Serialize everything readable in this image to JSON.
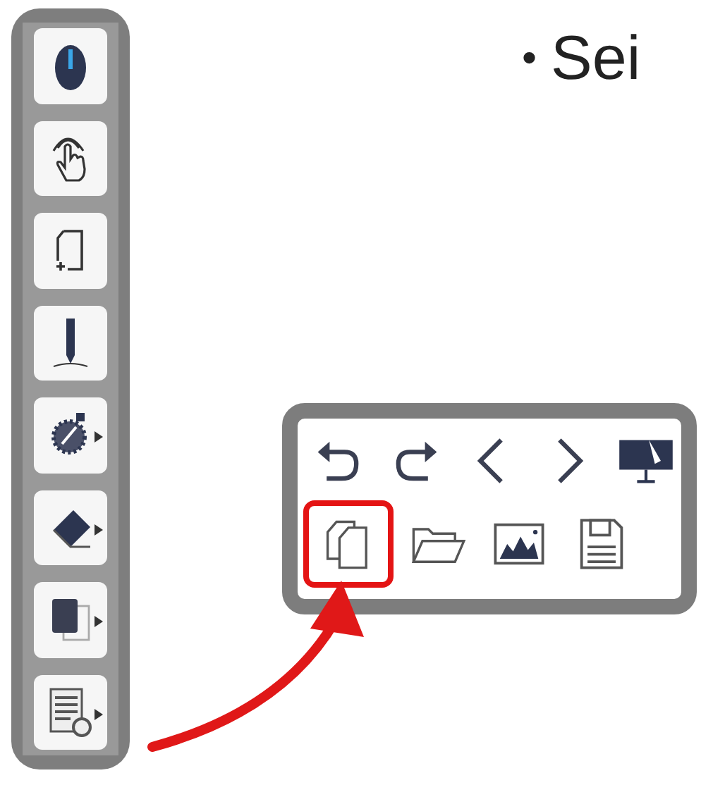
{
  "slide_text": {
    "bullet": "•",
    "text": "Sei"
  },
  "left_toolbar": {
    "tools": [
      {
        "kind": "mouse",
        "submenu": false
      },
      {
        "kind": "touch",
        "submenu": false
      },
      {
        "kind": "page",
        "submenu": false
      },
      {
        "kind": "pen",
        "submenu": false
      },
      {
        "kind": "dial",
        "submenu": true
      },
      {
        "kind": "eraser",
        "submenu": true
      },
      {
        "kind": "shape",
        "submenu": true
      },
      {
        "kind": "document",
        "submenu": true
      }
    ]
  },
  "floating_toolbar": {
    "rows": [
      [
        {
          "kind": "undo",
          "highlighted": false
        },
        {
          "kind": "redo",
          "highlighted": false
        },
        {
          "kind": "prev",
          "highlighted": false
        },
        {
          "kind": "next",
          "highlighted": false
        },
        {
          "kind": "board",
          "highlighted": false
        }
      ],
      [
        {
          "kind": "copy",
          "highlighted": true
        },
        {
          "kind": "folder",
          "highlighted": false
        },
        {
          "kind": "image",
          "highlighted": false
        },
        {
          "kind": "save",
          "highlighted": false
        }
      ]
    ]
  }
}
